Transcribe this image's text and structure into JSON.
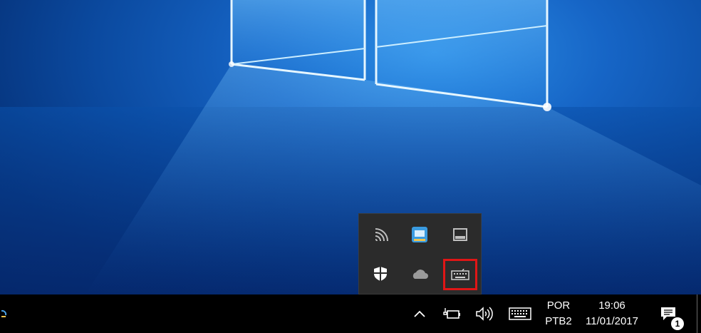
{
  "taskbar": {
    "language": {
      "line1": "POR",
      "line2": "PTB2"
    },
    "clock": {
      "time": "19:06",
      "date": "11/01/2017"
    },
    "notifications": {
      "count": "1"
    }
  },
  "tray_popup": {
    "icons": [
      "wifi-icon",
      "app-blue-icon",
      "tablet-icon",
      "defender-shield-icon",
      "onedrive-cloud-icon",
      "touch-keyboard-icon"
    ]
  },
  "colors": {
    "highlight": "#e01616",
    "taskbar": "#000000",
    "popup": "#2b2b2b"
  }
}
